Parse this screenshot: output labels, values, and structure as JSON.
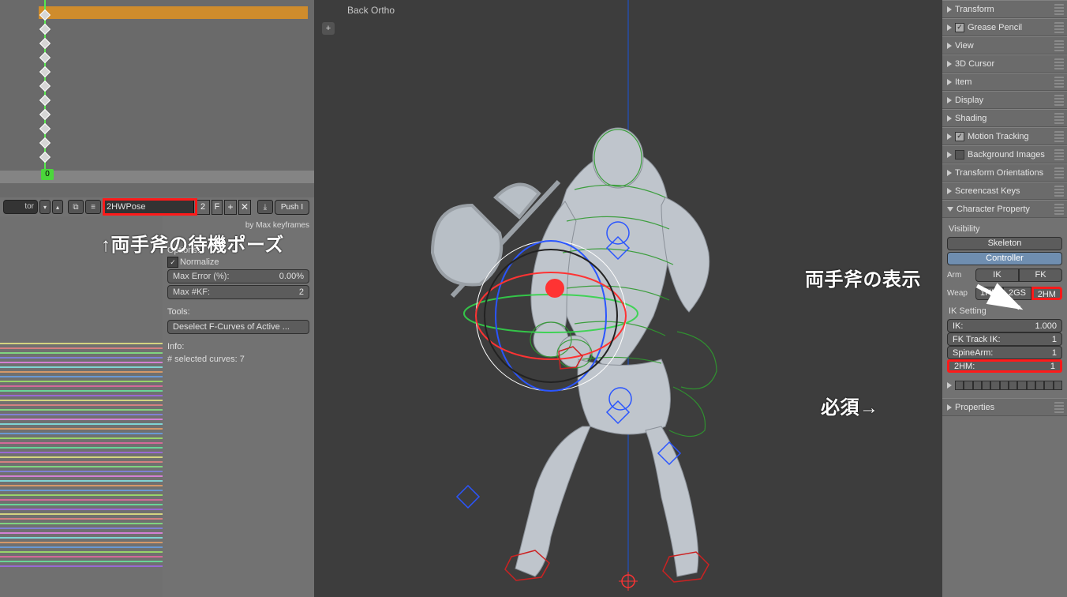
{
  "viewport": {
    "label": "Back Ortho",
    "plus": "+"
  },
  "dopesheet": {
    "editor_name": "tor",
    "action_name": "2HWPose",
    "users": "2",
    "fake_user": "F",
    "add": "+",
    "unlink": "✕",
    "push": "Push I",
    "frame_badge": "0",
    "subtext": "by Max keyframes"
  },
  "toolpanel": {
    "options_label": "Options:",
    "normalize_label": "Normalize",
    "max_error_label": "Max Error (%):",
    "max_error_value": "0.00%",
    "max_kf_label": "Max #KF:",
    "max_kf_value": "2",
    "tools_label": "Tools:",
    "deselect_btn": "Deselect F-Curves of Active ...",
    "info_label": "Info:",
    "info_text": "# selected curves: 7"
  },
  "npanel": {
    "sections": {
      "transform": "Transform",
      "grease_pencil": "Grease Pencil",
      "view": "View",
      "cursor": "3D Cursor",
      "item": "Item",
      "display": "Display",
      "shading": "Shading",
      "motion_tracking": "Motion Tracking",
      "bg_images": "Background Images",
      "transform_orient": "Transform Orientations",
      "screencast": "Screencast Keys",
      "char_prop": "Character Property",
      "properties": "Properties"
    },
    "char": {
      "visibility": "Visibility",
      "skeleton": "Skeleton",
      "controller": "Controller",
      "arm_label": "Arm",
      "arm_ik": "IK",
      "arm_fk": "FK",
      "weap_label": "Weap",
      "weap_1hm": "1HM",
      "weap_2gs": "2GS",
      "weap_2hm": "2HM",
      "ik_setting": "IK Setting",
      "ik_label": "IK:",
      "ik_value": "1.000",
      "fk_track_label": "FK Track IK:",
      "fk_track_value": "1",
      "spine_label": "SpineArm:",
      "spine_value": "1",
      "twohm_label": "2HM:",
      "twohm_value": "1"
    }
  },
  "annotations": {
    "top": "↑両手斧の待機ポーズ",
    "right_top": "両手斧の表示",
    "right_bottom": "必須→"
  }
}
